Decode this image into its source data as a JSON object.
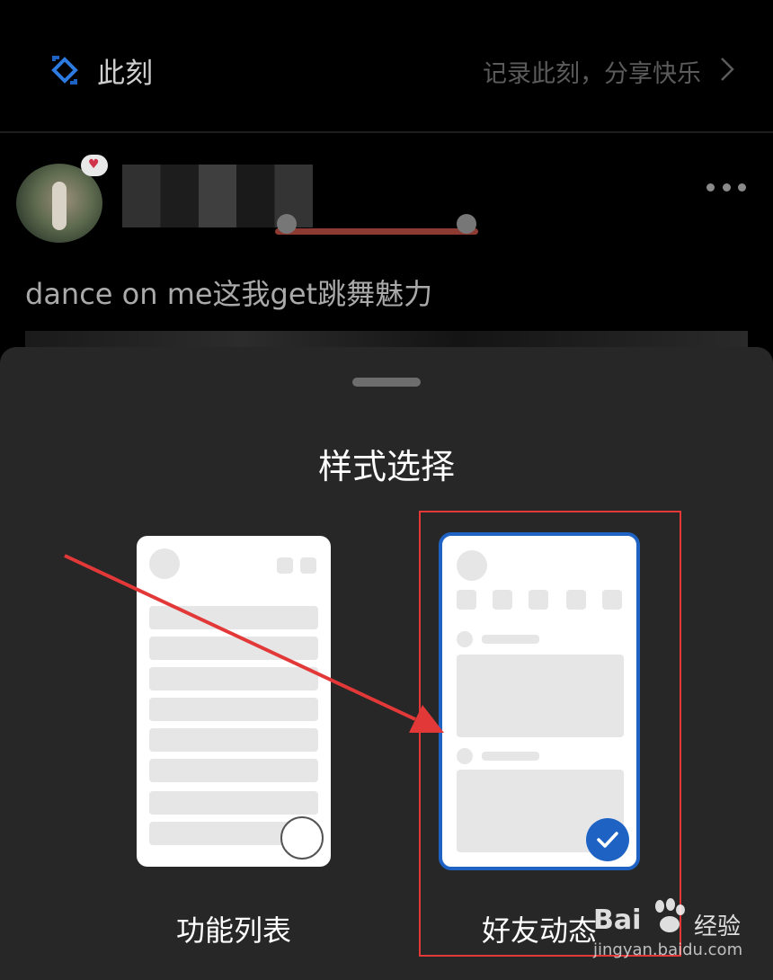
{
  "header": {
    "title": "此刻",
    "slogan": "记录此刻，分享快乐",
    "logo_icon": "moment-logo-icon",
    "chevron_icon": "chevron-right-icon"
  },
  "post": {
    "text": "dance on me这我get跳舞魅力",
    "more_icon": "more-horizontal-icon"
  },
  "sheet": {
    "title": "样式选择",
    "options": [
      {
        "label": "功能列表",
        "selected": false
      },
      {
        "label": "好友动态",
        "selected": true
      }
    ]
  },
  "watermark": {
    "brand": "Bai",
    "brand_suffix": "经验",
    "url": "jingyan.baidu.com"
  },
  "colors": {
    "accent": "#1e63c4",
    "annotation": "#e23838",
    "sheet_bg": "#272727"
  }
}
